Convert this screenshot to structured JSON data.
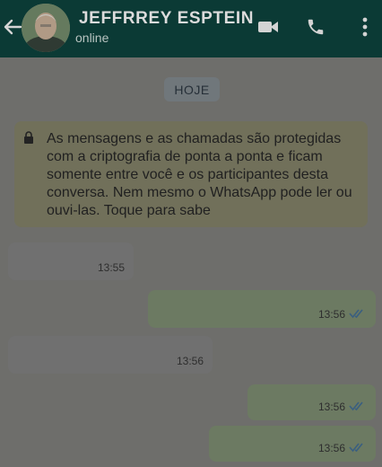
{
  "header": {
    "contact_name": "JEFFRREY ESPTEIN",
    "status": "online"
  },
  "chat": {
    "date_label": "HOJE",
    "encryption_notice": "As mensagens e as chamadas são protegidas com a criptografia de ponta a ponta e ficam somente entre você e os participantes desta conversa. Nem mesmo o WhatsApp pode ler ou ouvi-las. Toque para sabe",
    "messages": [
      {
        "direction": "in",
        "time": "13:55",
        "read": false
      },
      {
        "direction": "out",
        "time": "13:56",
        "read": true
      },
      {
        "direction": "in",
        "time": "13:56",
        "read": false
      },
      {
        "direction": "out",
        "time": "13:56",
        "read": true
      },
      {
        "direction": "out",
        "time": "13:56",
        "read": true
      }
    ]
  },
  "icons": {
    "back": "back-arrow-icon",
    "video": "video-call-icon",
    "phone": "phone-icon",
    "menu": "more-options-icon",
    "lock": "lock-icon",
    "read_receipt": "double-check-icon"
  },
  "colors": {
    "header_bg": "#0b3a35",
    "chat_bg": "#6b6b68",
    "incoming_bubble": "#707070",
    "outgoing_bubble": "#6c7a62",
    "notice_bg": "#71705a",
    "read_tick": "#3a5f80"
  }
}
